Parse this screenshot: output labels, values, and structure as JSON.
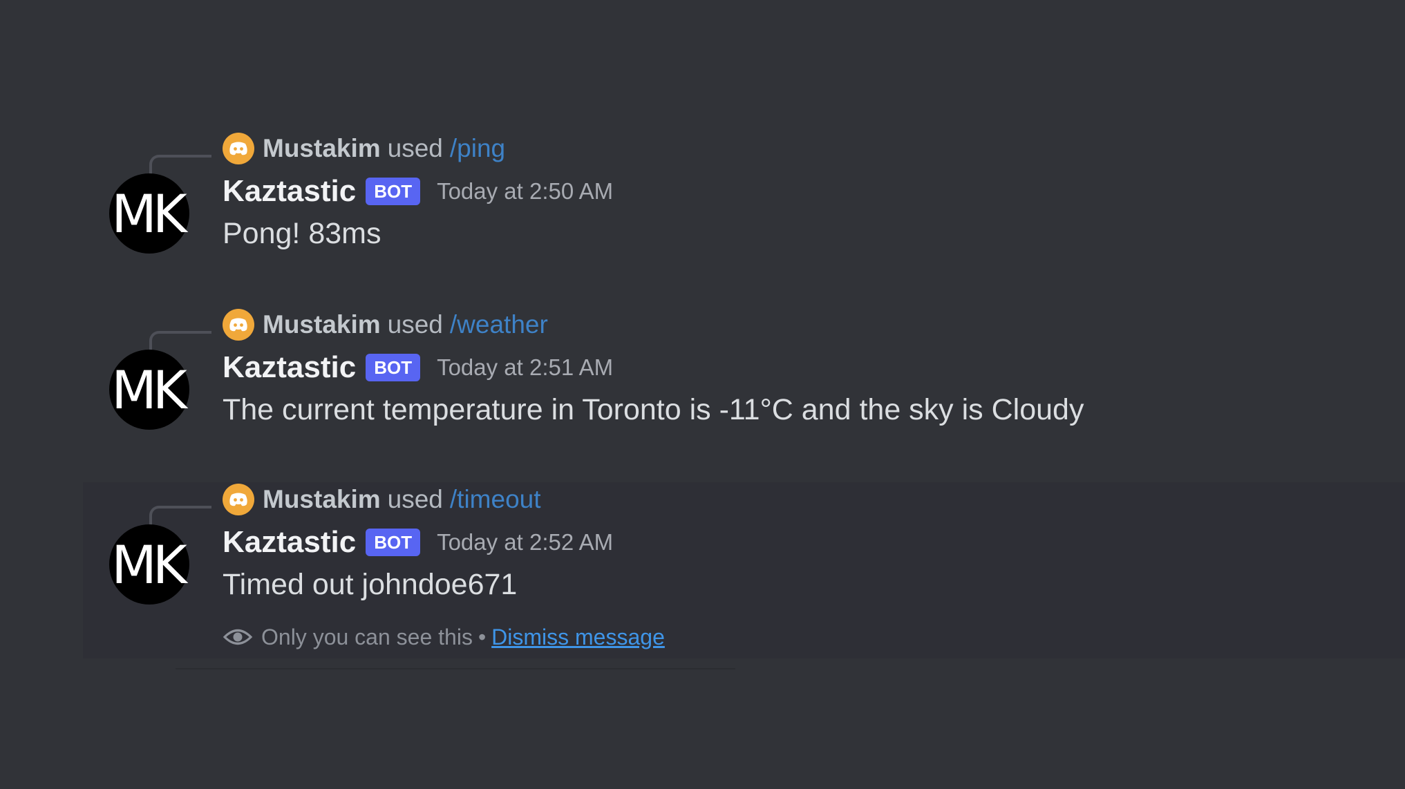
{
  "colors": {
    "background": "#313338",
    "highlight_background": "#2e2f36",
    "bot_tag": "#5865f2",
    "command": "#3e82c7",
    "link": "#3f95e8",
    "reply_avatar": "#f0a83a"
  },
  "icons": {
    "reply_avatar": "discord-logo-icon",
    "ephemeral": "eye-icon"
  },
  "messages": [
    {
      "reply": {
        "user": "Mustakim",
        "used": "used",
        "command": "/ping"
      },
      "avatar_initials": "MK",
      "username": "Kaztastic",
      "bot_tag": "BOT",
      "timestamp": "Today at 2:50 AM",
      "content": "Pong! 83ms"
    },
    {
      "reply": {
        "user": "Mustakim",
        "used": "used",
        "command": "/weather"
      },
      "avatar_initials": "MK",
      "username": "Kaztastic",
      "bot_tag": "BOT",
      "timestamp": "Today at 2:51 AM",
      "content": "The current temperature in Toronto is -11°C and the sky is Cloudy"
    },
    {
      "reply": {
        "user": "Mustakim",
        "used": "used",
        "command": "/timeout"
      },
      "avatar_initials": "MK",
      "username": "Kaztastic",
      "bot_tag": "BOT",
      "timestamp": "Today at 2:52 AM",
      "content": "Timed out johndoe671",
      "ephemeral": {
        "notice": "Only you can see this",
        "separator": "•",
        "dismiss_label": "Dismiss message"
      }
    }
  ]
}
